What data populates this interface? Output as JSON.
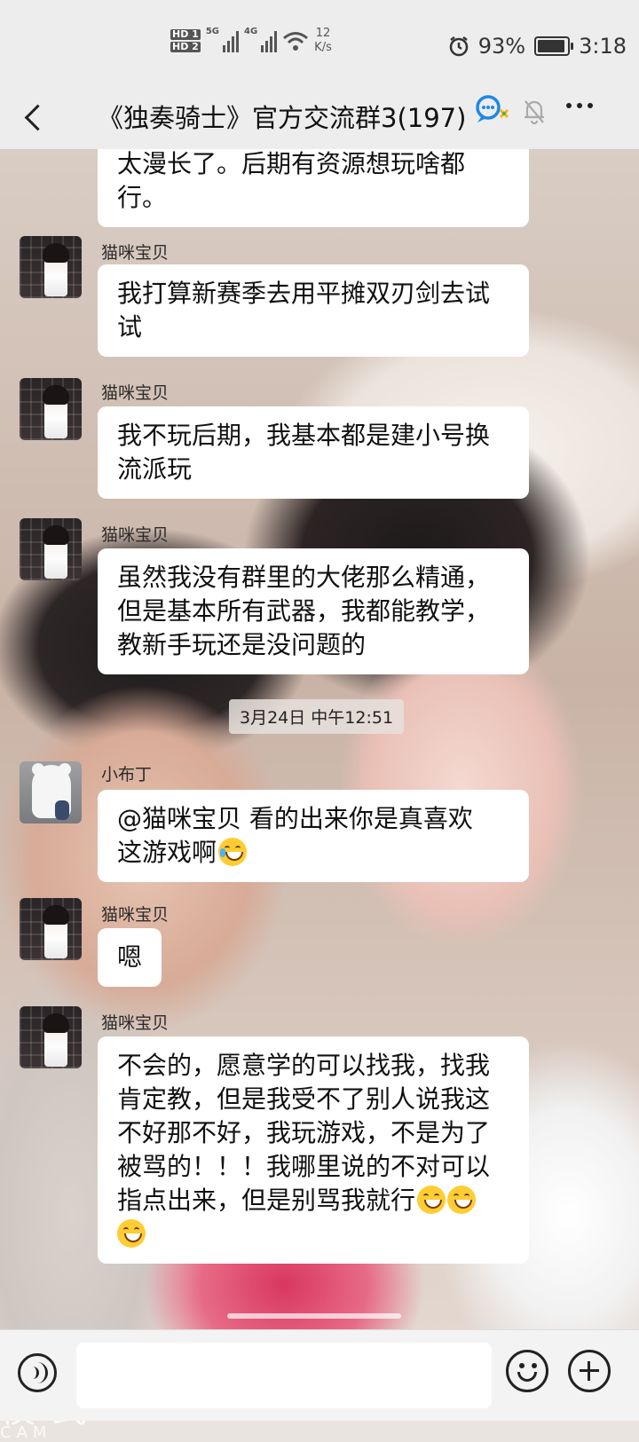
{
  "status_bar": {
    "hd1": "HD 1",
    "hd2": "HD 2",
    "net1": "5G",
    "net2": "4G",
    "speed_value": "12",
    "speed_unit": "K/s",
    "battery": "93%",
    "battery_level": 0.93,
    "time": "3:18"
  },
  "header": {
    "title": "《独奏骑士》官方交流群3(197)",
    "icons": [
      "back-icon",
      "qq-group-icon",
      "bell-muted-icon",
      "more-icon"
    ]
  },
  "messages": [
    {
      "sender": "",
      "text": "太漫长了。后期有资源想玩啥都行。",
      "lines": [
        "太漫长了。后期有资源想玩啥都",
        "行。"
      ]
    },
    {
      "sender": "猫咪宝贝",
      "lines": [
        "我打算新赛季去用平摊双刃剑去试",
        "试"
      ]
    },
    {
      "sender": "猫咪宝贝",
      "lines": [
        "我不玩后期，我基本都是建小号换",
        "流派玩"
      ]
    },
    {
      "sender": "猫咪宝贝",
      "lines": [
        "虽然我没有群里的大佬那么精通，",
        "但是基本所有武器，我都能教学，",
        "教新手玩还是没问题的"
      ]
    },
    {
      "sender": "小布丁",
      "mention": "@猫咪宝贝",
      "lines": [
        " 看的出来你是真喜欢",
        "这游戏啊"
      ],
      "emoji": "laugh-cry-emoji"
    },
    {
      "sender": "猫咪宝贝",
      "lines": [
        "嗯"
      ]
    },
    {
      "sender": "猫咪宝贝",
      "lines": [
        "不会的，愿意学的可以找我，找我",
        "肯定教，但是我受不了别人说我这",
        "不好那不好，我玩游戏，不是为了",
        "被骂的！！！我哪里说的不对可以",
        "指点出来，但是别骂我就行"
      ],
      "emoji": "grin-emoji"
    }
  ],
  "timestamp": "3月24日 中午12:51",
  "background_watermark": {
    "line1": "模式",
    "line2": "CAM"
  },
  "colors": {
    "bubble": "#ffffff",
    "bar_bg": "#ededed",
    "emoji": "#ffcc33"
  }
}
